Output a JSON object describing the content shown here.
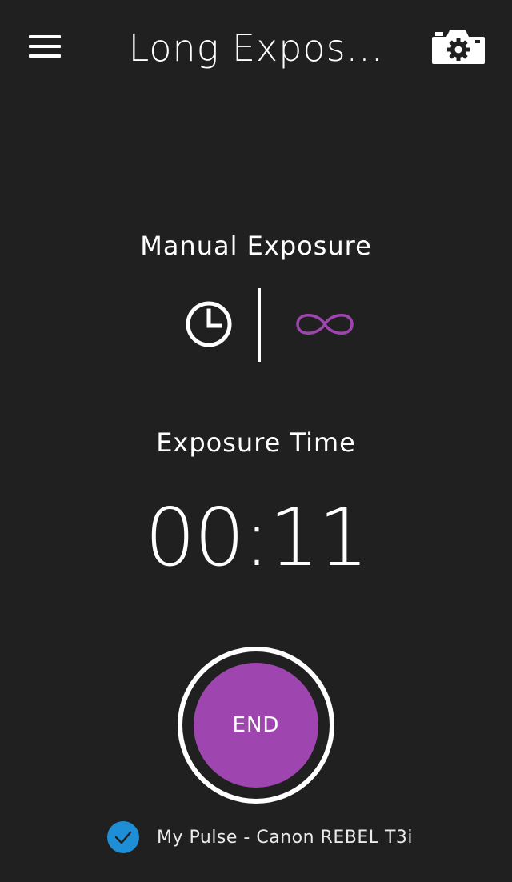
{
  "header": {
    "title": "Long Expos...",
    "menu_icon": "hamburger-menu-icon",
    "camera_settings_icon": "camera-settings-icon"
  },
  "mode": {
    "title": "Manual Exposure",
    "options": [
      {
        "icon": "clock-icon",
        "selected": false
      },
      {
        "icon": "infinity-icon",
        "selected": true
      }
    ]
  },
  "exposure": {
    "label": "Exposure Time",
    "time": "00:11"
  },
  "action": {
    "end_label": "END"
  },
  "device": {
    "name": "My Pulse - Canon REBEL T3i",
    "connected": true
  },
  "colors": {
    "background": "#202020",
    "accent_purple": "#9f45b0",
    "check_blue": "#1e8fd6",
    "text": "#ffffff"
  }
}
